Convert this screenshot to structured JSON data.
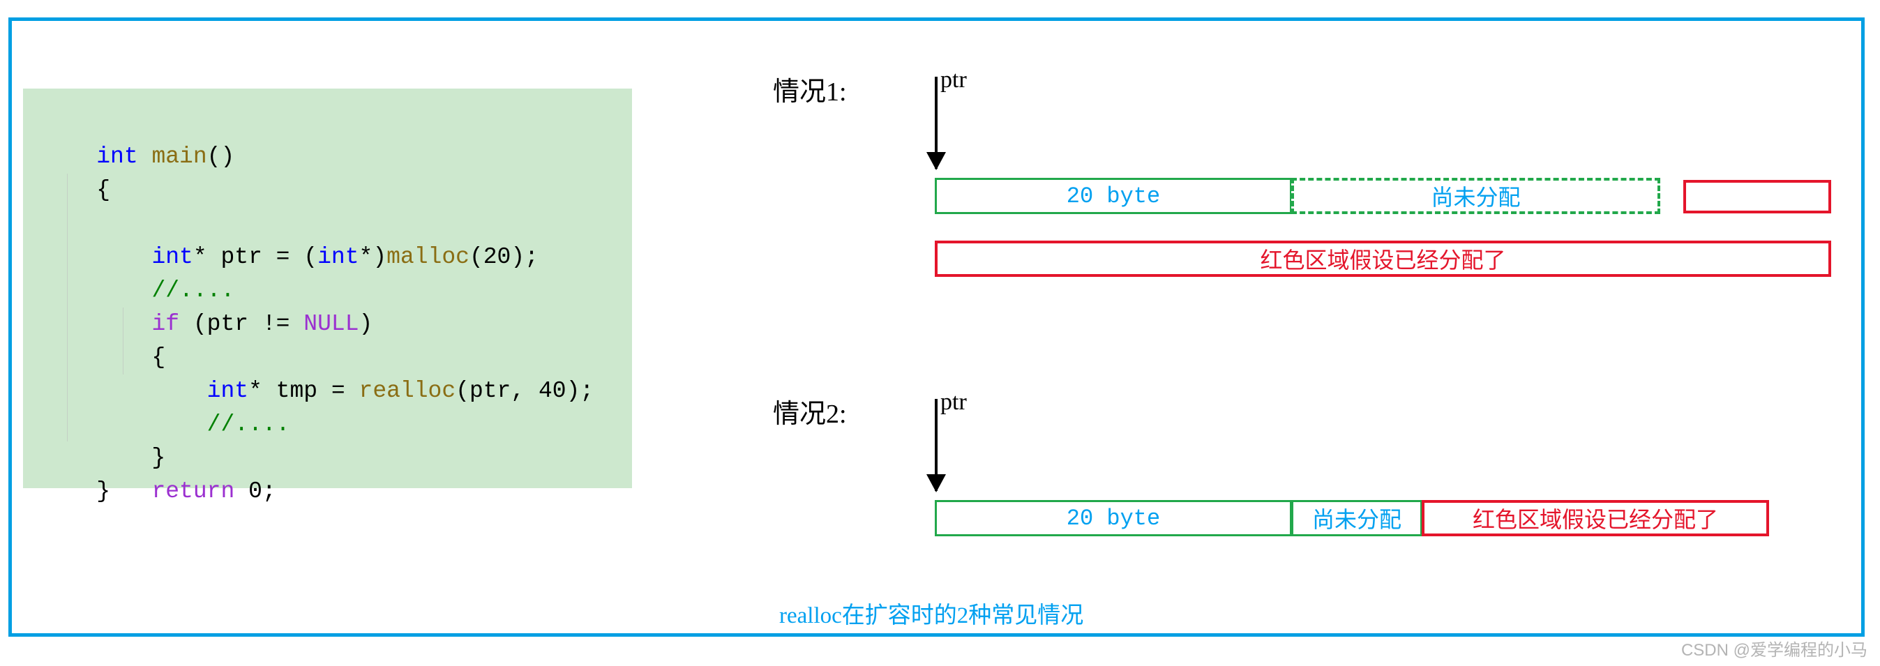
{
  "frame": {
    "border_color": "#009fe3"
  },
  "code_panel": {
    "background": "#cde8ce",
    "language": "c",
    "lines": [
      {
        "id": "l1",
        "text": "int main()"
      },
      {
        "id": "l2",
        "text": "{"
      },
      {
        "id": "l3",
        "text": "    int* ptr = (int*)malloc(20);"
      },
      {
        "id": "l4",
        "text": "    //...."
      },
      {
        "id": "l5",
        "text": "    if (ptr != NULL)"
      },
      {
        "id": "l6",
        "text": "    {"
      },
      {
        "id": "l7",
        "text": "        int* tmp = realloc(ptr, 40);"
      },
      {
        "id": "l8",
        "text": "        //...."
      },
      {
        "id": "l9",
        "text": "    }"
      },
      {
        "id": "l10",
        "text": "    return 0;"
      },
      {
        "id": "l11",
        "text": "}"
      }
    ],
    "syntax_colors": {
      "keyword": "#0000ff",
      "control": "#9b30d0",
      "function": "#8a6d14",
      "comment": "#008000",
      "plain": "#000000"
    }
  },
  "diagram": {
    "colors": {
      "green": "#22a84b",
      "blue_text": "#00a0f0",
      "red": "#e4152b",
      "black": "#000000"
    },
    "case1": {
      "label": "情况1:",
      "pointer_label": "ptr",
      "allocated_box": "20 byte",
      "unallocated_box": "尚未分配",
      "occupied_box": "",
      "note_box": "红色区域假设已经分配了"
    },
    "case2": {
      "label": "情况2:",
      "pointer_label": "ptr",
      "allocated_box": "20 byte",
      "unallocated_box": "尚未分配",
      "occupied_box": "红色区域假设已经分配了"
    },
    "caption": "realloc在扩容时的2种常见情况"
  },
  "watermark": {
    "text": "CSDN @爱学编程的小马"
  }
}
